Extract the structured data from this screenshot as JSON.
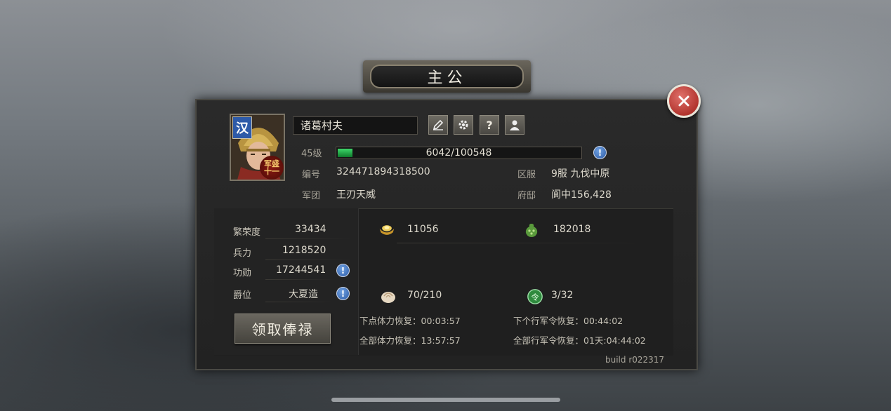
{
  "title": "主公",
  "player": {
    "name": "诸葛村夫",
    "faction": "汉",
    "badge_line1": "军盛",
    "badge_line2": "十一",
    "level": "45级",
    "xp_text": "6042/100548",
    "xp_progress": 0.06,
    "id_label": "编号",
    "id_value": "324471894318500",
    "server_label": "区服",
    "server_value": "9服 九伐中原",
    "legion_label": "军团",
    "legion_value": "王刃天威",
    "mansion_label": "府邸",
    "mansion_value": "阆中156,428"
  },
  "toolbar": {
    "edit_icon": "pencil-icon",
    "settings_icon": "gear-icon",
    "help_label": "?",
    "profile_icon": "person-icon"
  },
  "stats": {
    "prosperity_label": "繁荣度",
    "prosperity_value": "33434",
    "troops_label": "兵力",
    "troops_value": "1218520",
    "merit_label": "功勋",
    "merit_value": "17244541",
    "rank_label": "爵位",
    "rank_value": "大夏造"
  },
  "get_salary_label": "领取俸禄",
  "resources": {
    "gold_value": "11056",
    "jade_value": "182018",
    "stamina_value": "70/210",
    "orders_value": "3/32"
  },
  "timers": {
    "next_stamina": "下点体力恢复：00:03:57",
    "all_stamina": "全部体力恢复：13:57:57",
    "next_order": "下个行军令恢复：00:44:02",
    "all_orders": "全部行军令恢复：01天:04:44:02"
  },
  "build": "build r022317",
  "info_symbol": "!",
  "colors": {
    "accent_close": "#b2352e",
    "xp_fill": "#1fa044",
    "info_blue": "#2e5da8"
  }
}
